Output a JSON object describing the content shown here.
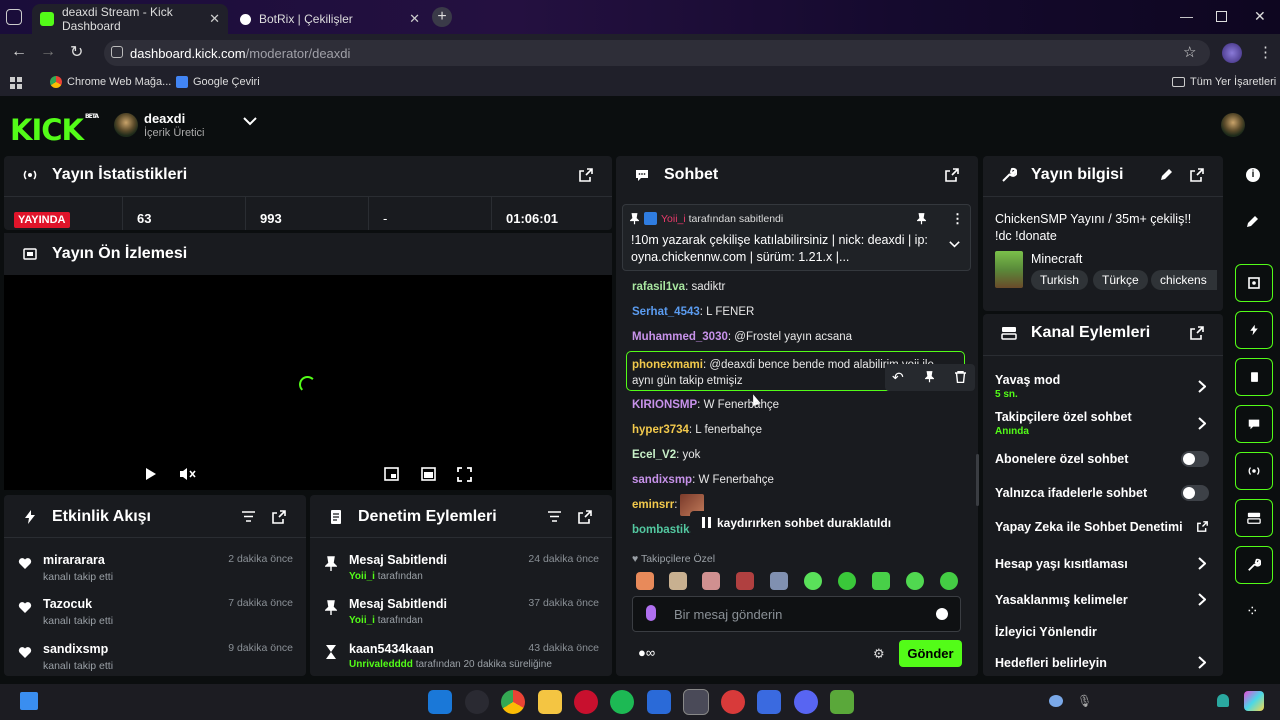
{
  "browser": {
    "tabs": [
      {
        "title": "deaxdi Stream - Kick Dashboard",
        "active": true
      },
      {
        "title": "BotRix | Çekilişler",
        "active": false
      }
    ],
    "url_host": "dashboard.kick.com",
    "url_path": "/moderator/deaxdi",
    "bookmarks": [
      "Chrome Web Mağa...",
      "Google Çeviri"
    ],
    "all_bookmarks": "Tüm Yer İşaretleri"
  },
  "header": {
    "logo": "KICK",
    "logo_badge": "BETA",
    "username": "deaxdi",
    "role": "İçerik Üretici"
  },
  "stats": {
    "title": "Yayın İstatistikleri",
    "live_badge": "YAYINDA",
    "viewers": "63",
    "followers": "993",
    "subs": "-",
    "uptime": "01:06:01"
  },
  "preview": {
    "title": "Yayın Ön İzlemesi"
  },
  "activity": {
    "title": "Etkinlik Akışı",
    "items": [
      {
        "name": "mirararara",
        "desc": "kanalı takip etti",
        "time": "2 dakika önce"
      },
      {
        "name": "Tazocuk",
        "desc": "kanalı takip etti",
        "time": "7 dakika önce"
      },
      {
        "name": "sandixsmp",
        "desc": "kanalı takip etti",
        "time": "9 dakika önce"
      }
    ]
  },
  "moderation": {
    "title": "Denetim Eylemleri",
    "items": [
      {
        "title": "Mesaj Sabitlendi",
        "user": "Yoii_i",
        "suffix": "tarafından",
        "time": "24 dakika önce"
      },
      {
        "title": "Mesaj Sabitlendi",
        "user": "Yoii_i",
        "suffix": "tarafından",
        "time": "37 dakika önce"
      },
      {
        "title": "kaan5434kaan",
        "user": "Unrivaledddd",
        "suffix": "tarafından 20 dakika süreliğine",
        "time": "43 dakika önce"
      }
    ]
  },
  "chat": {
    "title": "Sohbet",
    "pinned_by_user": "Yoii_i",
    "pinned_by_text": "tarafından sabitlendi",
    "pinned_message": "!10m yazarak çekilişe katılabilirsiniz | nick: deaxdi | ip: oyna.chickennw.com | sürüm: 1.21.x |...",
    "messages": [
      {
        "user": "rafasil1va",
        "color": "#a8e6a0",
        "text": "sadiktr"
      },
      {
        "user": "Serhat_4543",
        "color": "#5b9cf0",
        "text": "L FENER"
      },
      {
        "user": "Muhammed_3030",
        "color": "#c792ea",
        "text": "@Frostel yayın acsana"
      },
      {
        "user": "phonexmami",
        "color": "#f2c94c",
        "text": "@deaxdi bence bende mod alabilirim yoii ile aynı gün takip etmişiz"
      },
      {
        "user": "KIRIONSMP",
        "color": "#c792ea",
        "text": "W Fenerbahçe"
      },
      {
        "user": "hyper3734",
        "color": "#f2c94c",
        "text": "L fenerbahçe"
      },
      {
        "user": "Ecel_V2",
        "color": "#c8f0c8",
        "text": "yok"
      },
      {
        "user": "sandixsmp",
        "color": "#c792ea",
        "text": "W Fenerbahçe"
      },
      {
        "user": "eminsrr",
        "color": "#f2c94c",
        "text": ""
      },
      {
        "user": "bombastika",
        "color": "#53c8a0",
        "text": ""
      }
    ],
    "paused_notice": "kaydırırken sohbet duraklatıldı",
    "followers_only_label": "Takipçilere Özel",
    "input_placeholder": "Bir mesaj gönderin",
    "send_label": "Gönder"
  },
  "stream_info": {
    "title": "Yayın bilgisi",
    "stream_title": "ChickenSMP Yayını / 35m+ çekiliş!! !dc !donate",
    "category": "Minecraft",
    "tags": [
      "Turkish",
      "Türkçe",
      "chickens"
    ]
  },
  "channel_actions": {
    "title": "Kanal Eylemleri",
    "items": [
      {
        "label": "Yavaş mod",
        "sub": "5 sn.",
        "control": "chevron"
      },
      {
        "label": "Takipçilere özel sohbet",
        "sub": "Anında",
        "control": "chevron"
      },
      {
        "label": "Abonelere özel sohbet",
        "sub": "",
        "control": "toggle"
      },
      {
        "label": "Yalnızca ifadelerle sohbet",
        "sub": "",
        "control": "toggle"
      },
      {
        "label": "Yapay Zeka ile Sohbet Denetimi",
        "sub": "",
        "control": "external"
      },
      {
        "label": "Hesap yaşı kısıtlaması",
        "sub": "",
        "control": "chevron"
      },
      {
        "label": "Yasaklanmış kelimeler",
        "sub": "",
        "control": "chevron"
      },
      {
        "label": "İzleyici Yönlendir",
        "sub": "",
        "control": "none"
      },
      {
        "label": "Hedefleri belirleyin",
        "sub": "",
        "control": "chevron"
      }
    ]
  },
  "colors": {
    "accent": "#53fc18",
    "live": "#e0142a",
    "panel": "#191b1f",
    "background": "#0b0e0f"
  }
}
